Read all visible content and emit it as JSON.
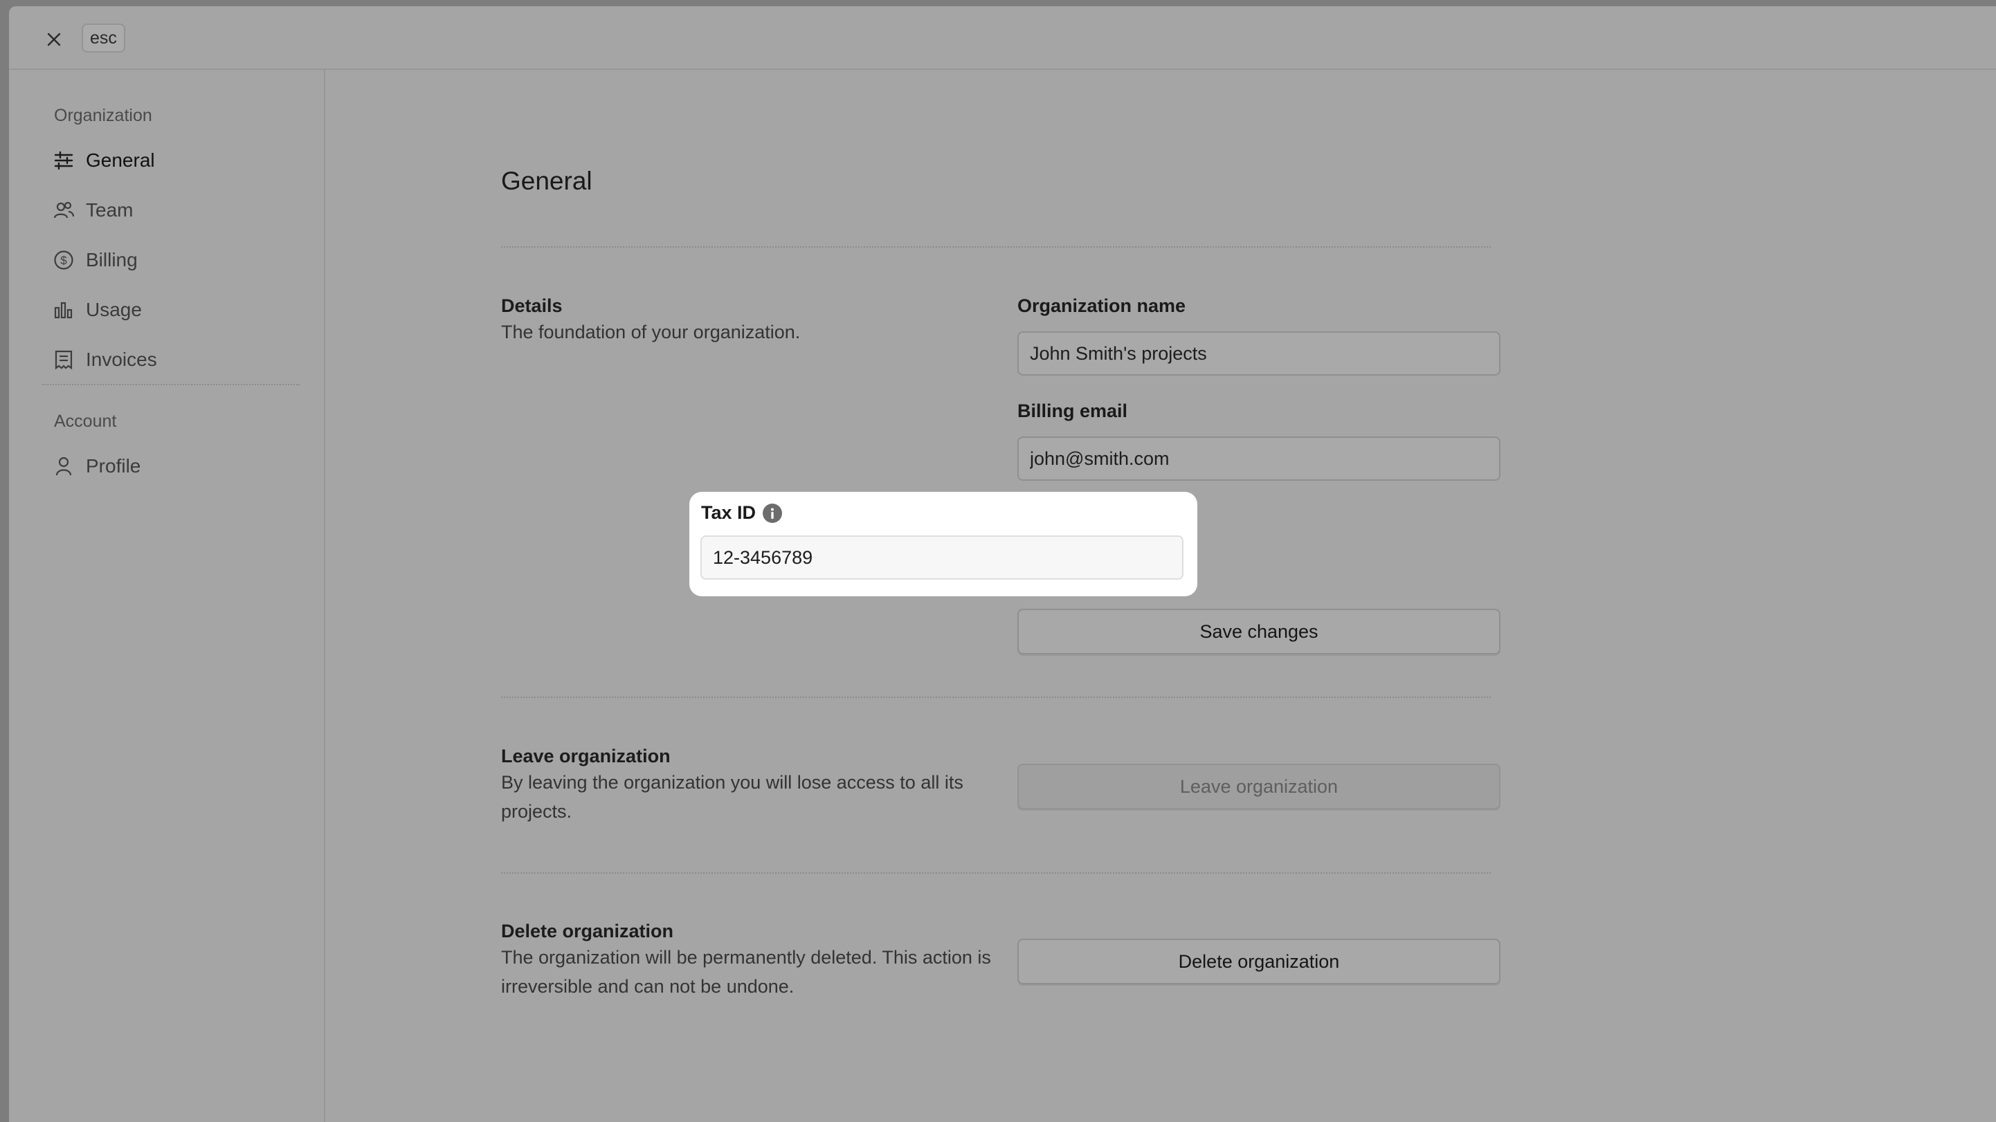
{
  "topbar": {
    "esc_label": "esc"
  },
  "sidebar": {
    "org_heading": "Organization",
    "org_items": [
      {
        "label": "General",
        "icon": "sliders-icon"
      },
      {
        "label": "Team",
        "icon": "users-icon"
      },
      {
        "label": "Billing",
        "icon": "dollar-circle-icon"
      },
      {
        "label": "Usage",
        "icon": "bar-chart-icon"
      },
      {
        "label": "Invoices",
        "icon": "receipt-icon"
      }
    ],
    "account_heading": "Account",
    "account_items": [
      {
        "label": "Profile",
        "icon": "user-icon"
      }
    ],
    "active": "General"
  },
  "main": {
    "title": "General",
    "details": {
      "title": "Details",
      "description": "The foundation of your organization.",
      "org_name_label": "Organization name",
      "org_name_value": "John Smith's projects",
      "billing_email_label": "Billing email",
      "billing_email_value": "john@smith.com",
      "tax_id_label": "Tax ID",
      "tax_id_value": "12-3456789",
      "save_label": "Save changes"
    },
    "leave": {
      "title": "Leave organization",
      "description": "By leaving the organization you will lose access to all its projects.",
      "button_label": "Leave organization"
    },
    "delete": {
      "title": "Delete organization",
      "description": "The organization will be permanently deleted. This action is irreversible and can not be undone.",
      "button_label": "Delete organization"
    }
  },
  "colors": {
    "overlay": "#a5a5a5",
    "highlight": "#ffffff"
  }
}
